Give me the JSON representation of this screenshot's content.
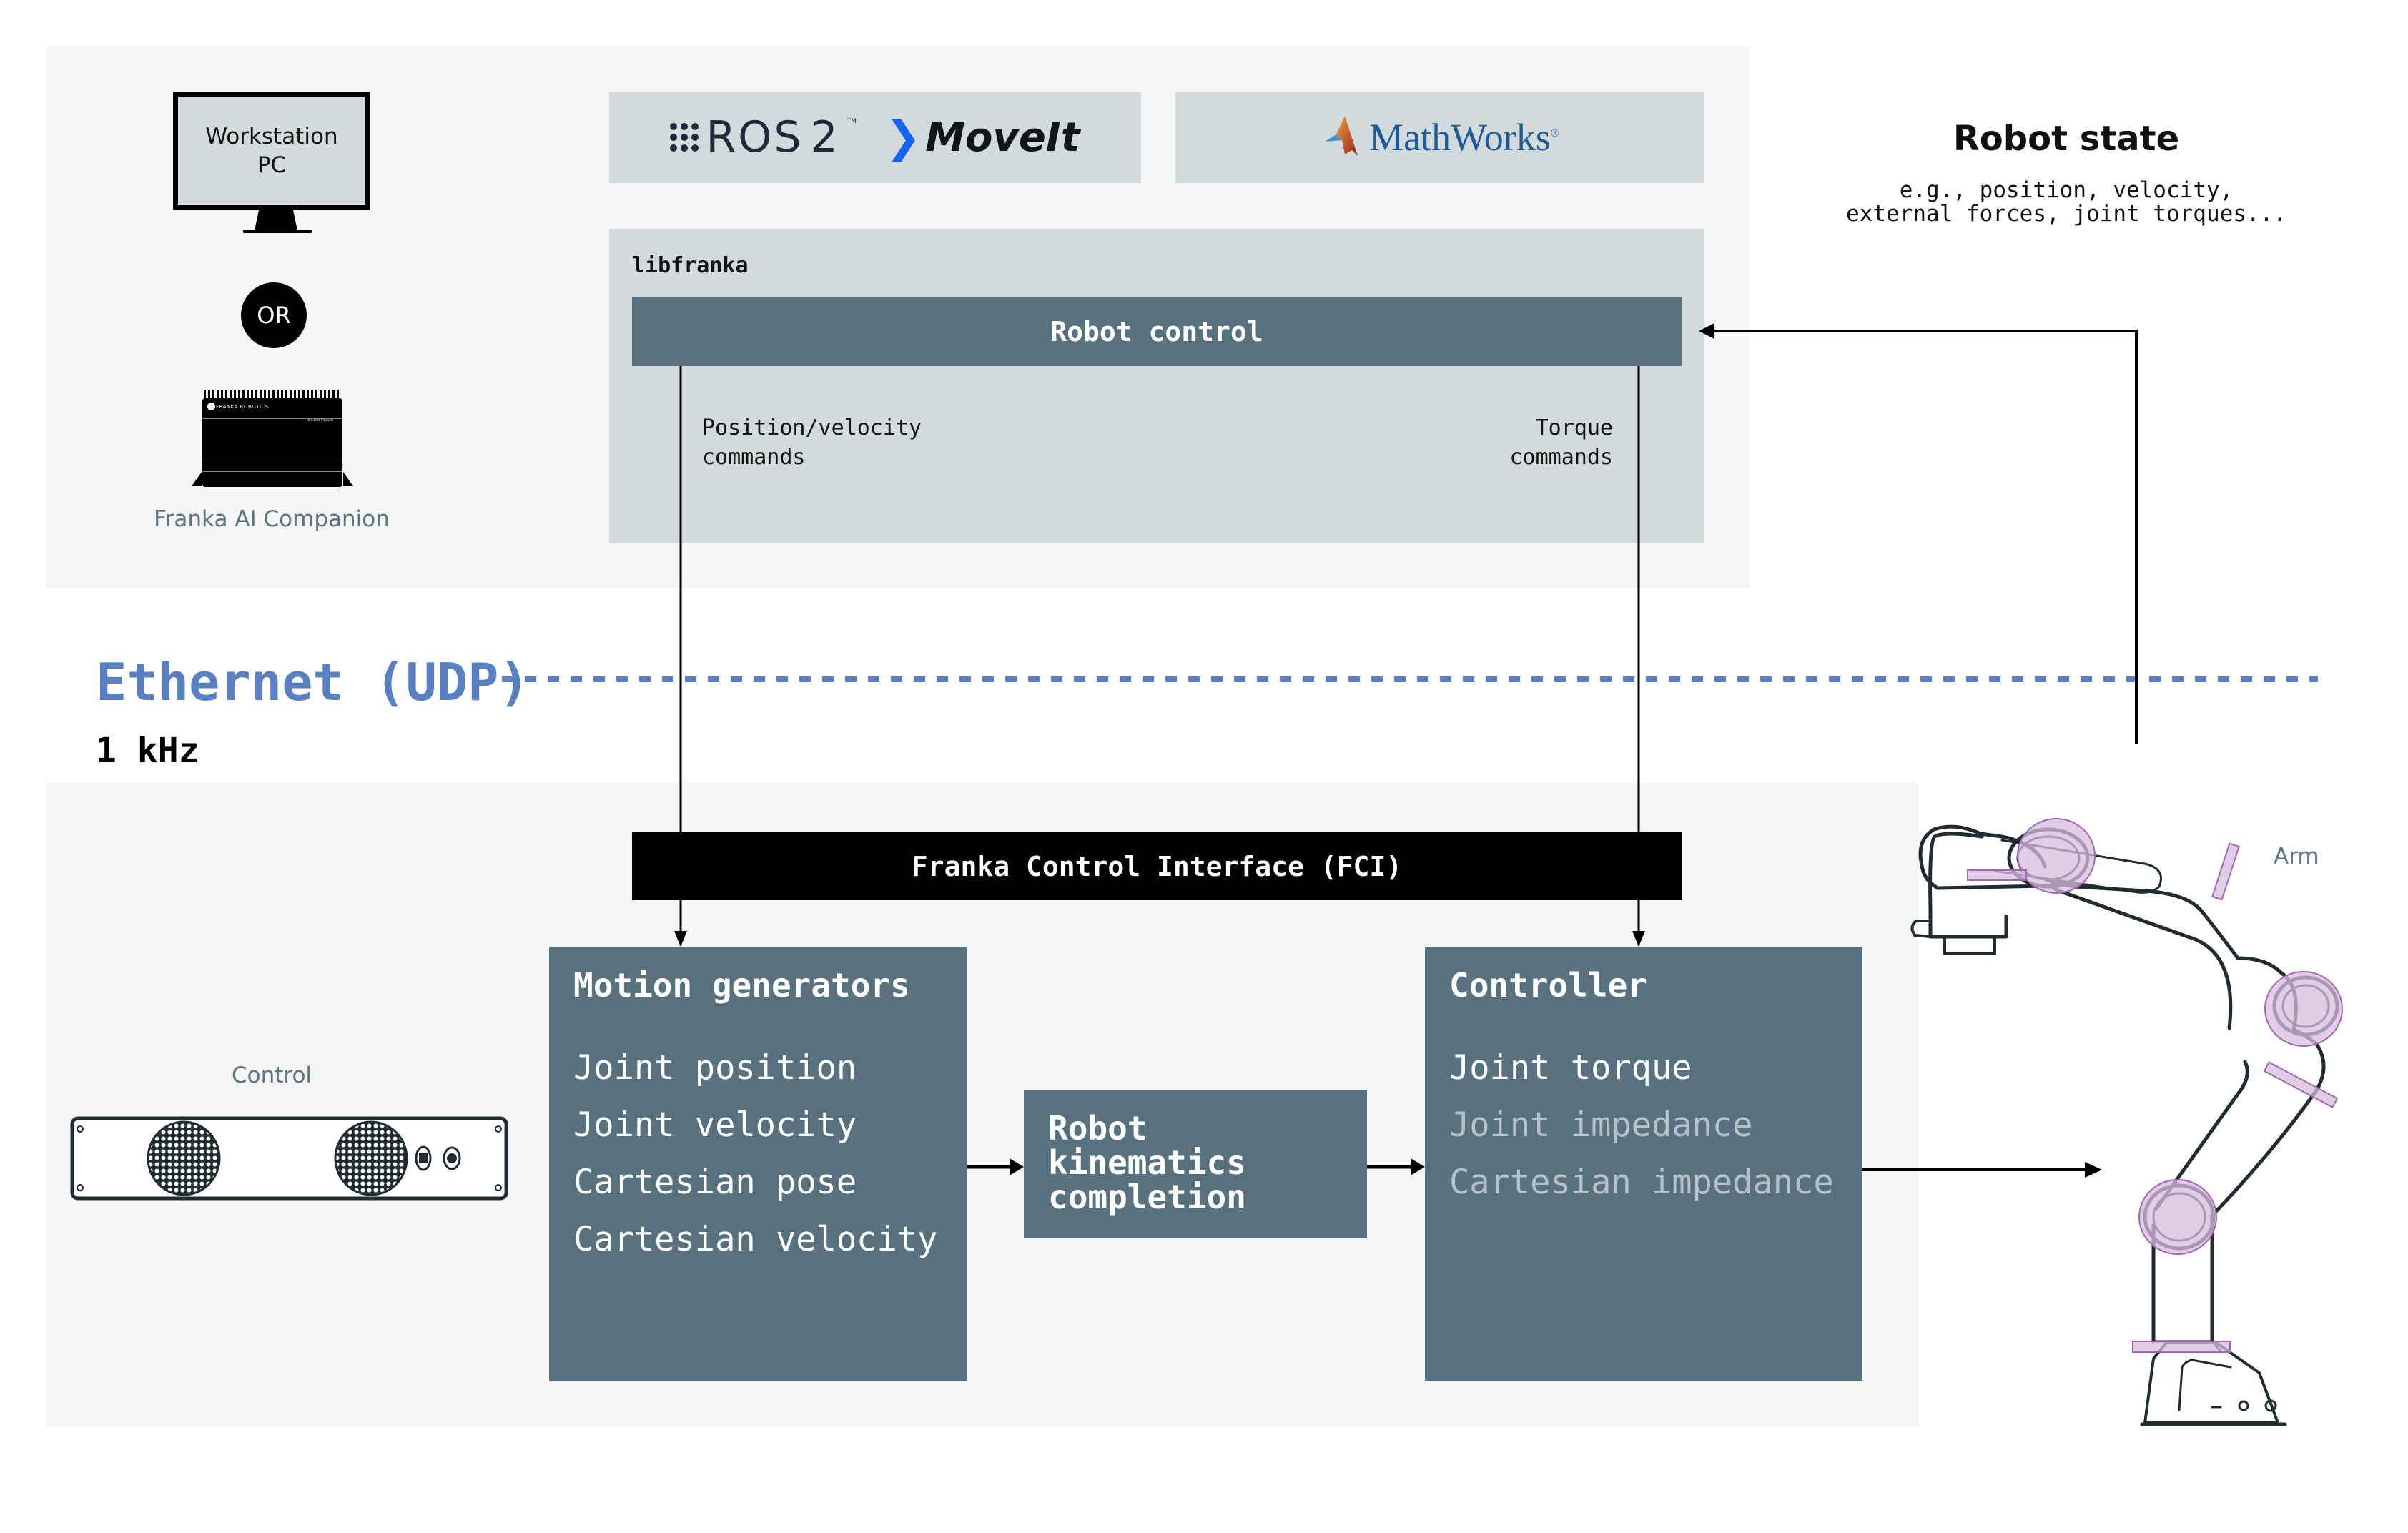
{
  "host": {
    "workstation_label": "Workstation\nPC",
    "or_label": "OR",
    "ai_companion": {
      "device_brand": "FRANKA ROBOTICS",
      "device_model": "AI COMPANION",
      "label": "Franka AI Companion"
    }
  },
  "integrations": {
    "ros": {
      "name": "ROS",
      "version": "2",
      "tm": "TM"
    },
    "moveit": {
      "name": "MoveIt"
    },
    "mathworks": {
      "name": "MathWorks",
      "reg": "®"
    }
  },
  "libfranka": {
    "label": "libfranka",
    "robot_control": "Robot control",
    "position_velocity_commands": "Position/velocity\ncommands",
    "torque_commands": "Torque\ncommands"
  },
  "robot_state": {
    "title": "Robot state",
    "description": "e.g., position, velocity,\nexternal forces, joint torques..."
  },
  "network": {
    "protocol_label": "Ethernet (UDP)",
    "rate_label": "1 kHz",
    "color": "#5a80c4"
  },
  "fci": {
    "label": "Franka Control Interface (FCI)"
  },
  "motion_generators": {
    "title": "Motion generators",
    "items": [
      {
        "label": "Joint position",
        "active": true
      },
      {
        "label": "Joint velocity",
        "active": true
      },
      {
        "label": "Cartesian pose",
        "active": true
      },
      {
        "label": "Cartesian velocity",
        "active": true
      }
    ]
  },
  "kinematics": {
    "title": "Robot\nkinematics\ncompletion"
  },
  "controller": {
    "title": "Controller",
    "items": [
      {
        "label": "Joint torque",
        "active": true
      },
      {
        "label": "Joint impedance",
        "active": false
      },
      {
        "label": "Cartesian impedance",
        "active": false
      }
    ]
  },
  "hardware": {
    "control_label": "Control",
    "arm_label": "Arm"
  },
  "colors": {
    "slate": "#58717e",
    "panel": "#f4f6f5",
    "grey_box": "#d3dadc",
    "joint_highlight": "#dcc6e0"
  }
}
